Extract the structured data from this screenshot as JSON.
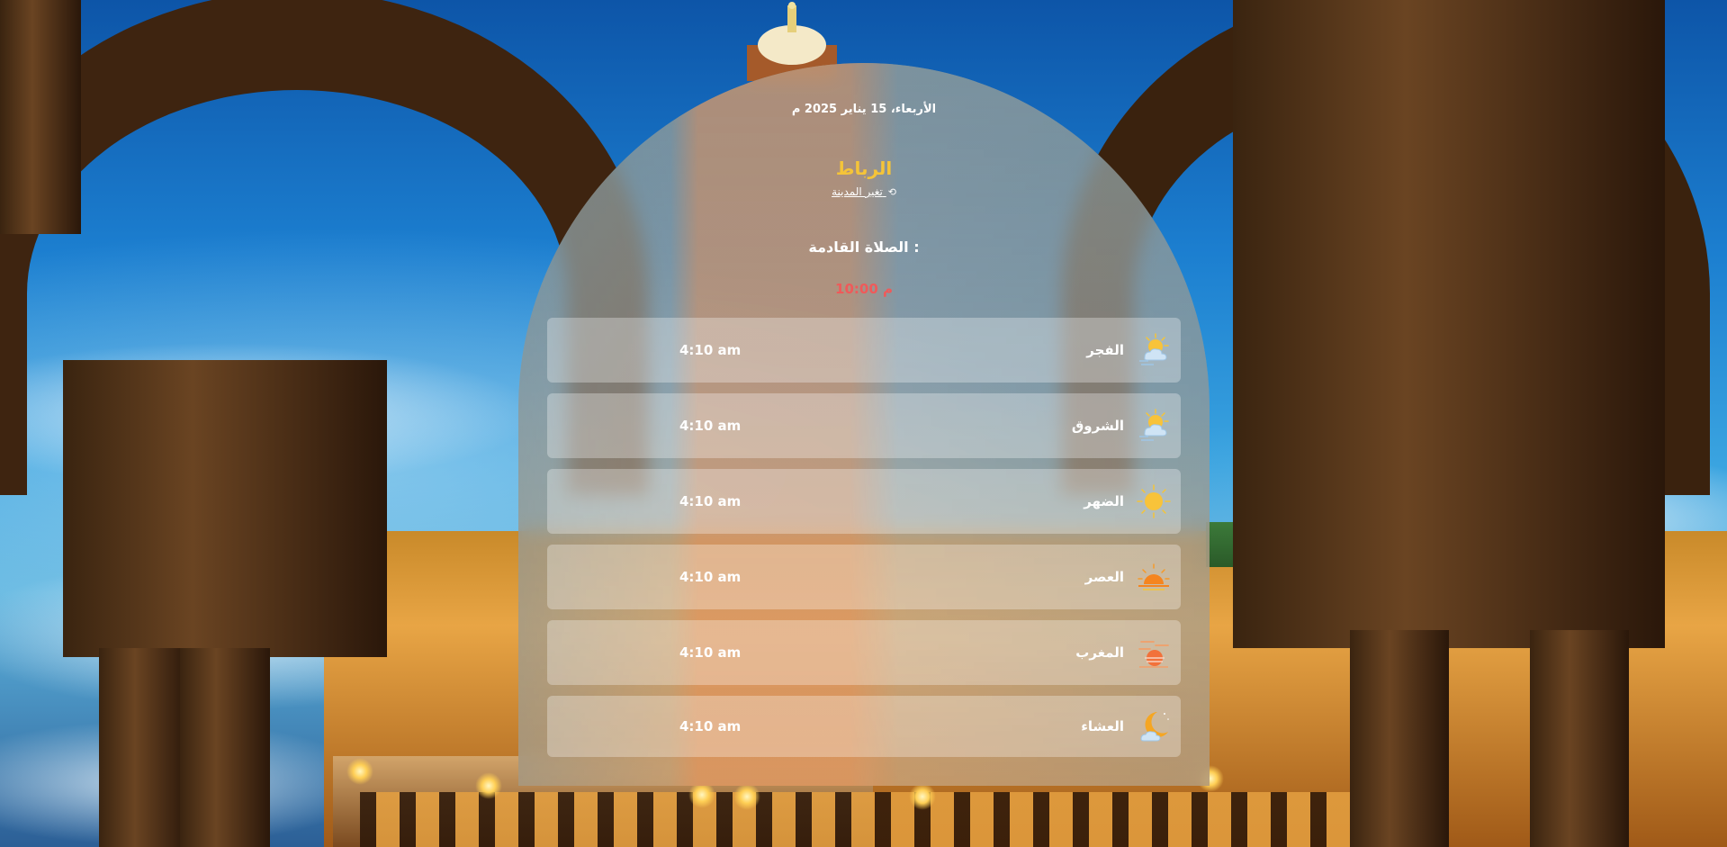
{
  "date": "الأربعاء، 15 يناير 2025 م",
  "city": "الرباط",
  "change_city": "تغير المدينة",
  "next_prayer_label": "الصلاة القادمة :",
  "next_prayer_time": "10:00 م",
  "prayers": [
    {
      "name": "الفجر",
      "time": "4:10 am",
      "icon": "sun-cloud-icon"
    },
    {
      "name": "الشروق",
      "time": "4:10 am",
      "icon": "sun-cloud-icon"
    },
    {
      "name": "الضهر",
      "time": "4:10 am",
      "icon": "sun-icon"
    },
    {
      "name": "العصر",
      "time": "4:10 am",
      "icon": "sunset-icon"
    },
    {
      "name": "المغرب",
      "time": "4:10 am",
      "icon": "sun-haze-icon"
    },
    {
      "name": "العشاء",
      "time": "4:10 am",
      "icon": "moon-cloud-icon"
    }
  ],
  "colors": {
    "city": "#f5c438",
    "next_time": "#ef5a5a"
  }
}
